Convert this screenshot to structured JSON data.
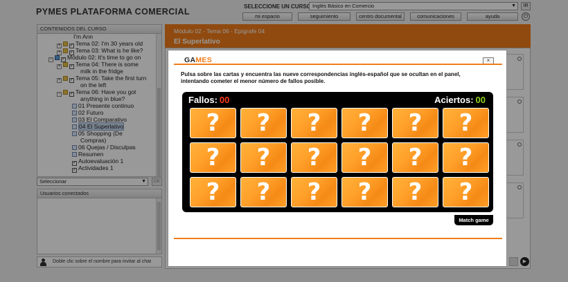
{
  "app": {
    "title": "PYMES PLATAFORMA COMERCIAL",
    "course_label": "SELECCIONE UN CURSO:",
    "course_value": "Inglés Básico en Comercio",
    "ir_label": "IR",
    "nav": [
      "mi espacio",
      "seguimiento",
      "centro documental",
      "comunicaciones",
      "ayuda"
    ],
    "power_icon": "power-icon"
  },
  "sidebar": {
    "header": "CONTENIDOS DEL CURSO",
    "items": [
      {
        "label": "I'm Ann"
      },
      {
        "label": "Tema 02: I'm 30 years old"
      },
      {
        "label": "Tema 03: What is he like?"
      },
      {
        "label": "Módulo 02: It's time to go on"
      },
      {
        "label": "Tema 04: There is some"
      },
      {
        "label": "milk in the fridge"
      },
      {
        "label": "Tema 05: Take the first turn"
      },
      {
        "label": "on the left"
      },
      {
        "label": "Tema 06: Have you got"
      },
      {
        "label": "anything in blue?"
      },
      {
        "label": "01 Presente continuo"
      },
      {
        "label": "02 Futuro"
      },
      {
        "label": "03 El Comparativo"
      },
      {
        "label": "04 El Superlativo"
      },
      {
        "label": "05 Shopping (De"
      },
      {
        "label": "Compras)"
      },
      {
        "label": "06 Quejas / Disculpas"
      },
      {
        "label": "Resumen"
      },
      {
        "label": "Autoevaluación 1"
      },
      {
        "label": "Actividades 1"
      }
    ],
    "select_placeholder": "Seleccionar",
    "ok_label": "OK",
    "users_header": "Usuarios conectados",
    "chat_hint": "Doble clic sobre el nombre para invitar al chat"
  },
  "content": {
    "breadcrumb": "Módulo 02 - Tema 06 - Epígrafe 04",
    "subtitle": "El Superlativo"
  },
  "modal": {
    "logo_ga": "GA",
    "logo_mes": "MES",
    "close_label": "×",
    "instructions": "Pulsa sobre las cartas y encuentra las nueve correspondencias inglés-español que se ocultan en el panel, intentando cometer el menor número de fallos posible.",
    "fallos_label": "Fallos:",
    "fallos_value": "00",
    "aciertos_label": "Aciertos:",
    "aciertos_value": "00",
    "card_symbol": "?",
    "card_count": 18,
    "match_label": "Match game"
  },
  "colors": {
    "accent": "#f07c19",
    "fallos": "#ff3b1e",
    "aciertos": "#8fd11d"
  }
}
